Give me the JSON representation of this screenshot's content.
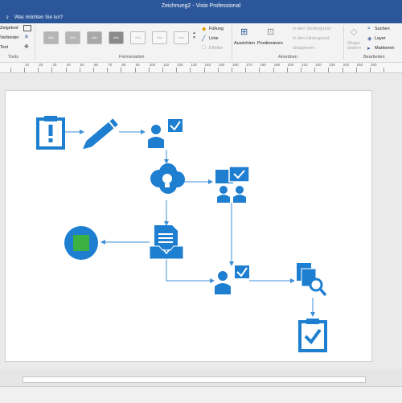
{
  "titlebar": {
    "title": "Zeichnung2  -  Visio Professional"
  },
  "tellme": {
    "placeholder": "Was möchten Sie tun?"
  },
  "ribbon": {
    "tools": {
      "items": [
        "Zeigetool",
        "Verbinder",
        "Text"
      ],
      "group_label": "Tools"
    },
    "shape_styles": {
      "swatch_label": "Abc",
      "group_label": "Formenarten"
    },
    "fill": {
      "items": [
        "Füllung",
        "Linie",
        "Effekte"
      ]
    },
    "arrange": {
      "align_label": "Ausrichten",
      "position_label": "Positionieren",
      "items": [
        "In den Vordergrund",
        "In den Hintergrund",
        "Gruppieren"
      ],
      "group_label": "Anordnen"
    },
    "editing": {
      "shape_change_label": "Shape ändern",
      "items": [
        "Suchen",
        "Layer",
        "Markieren"
      ],
      "group_label": "Bearbeiten"
    }
  },
  "ruler": {
    "ticks": [
      "10",
      "20",
      "30",
      "40",
      "50",
      "60",
      "70",
      "80",
      "90",
      "100",
      "110",
      "120",
      "130",
      "140",
      "150",
      "160",
      "170",
      "180",
      "190",
      "200",
      "210",
      "220",
      "230",
      "240",
      "250",
      "260"
    ]
  },
  "colors": {
    "accent": "#2b579a",
    "icon_blue": "#1e7fd0",
    "connector": "#3d8fd6",
    "green": "#3cb043"
  }
}
